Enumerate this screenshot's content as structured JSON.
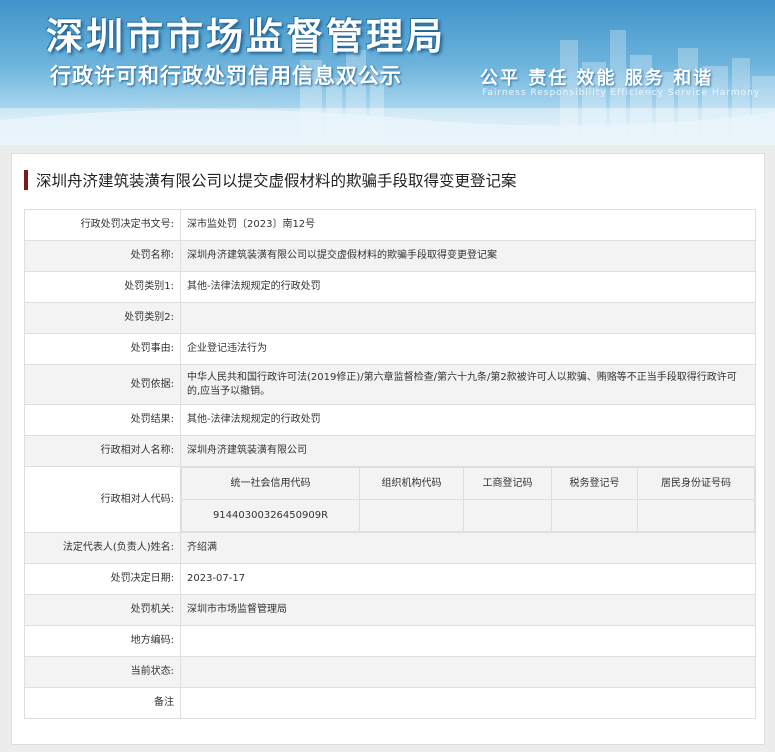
{
  "banner": {
    "title": "深圳市市场监督管理局",
    "subtitle": "行政许可和行政处罚信用信息双公示",
    "slogan": "公平  责任  效能  服务  和谐",
    "slogan_en": "Fairness  Responsibility  Efficiency  Service  Harmony"
  },
  "case_title": "深圳舟济建筑装潢有限公司以提交虚假材料的欺骗手段取得变更登记案",
  "fields": {
    "decision_no": {
      "label": "行政处罚决定书文号:",
      "value": "深市监处罚〔2023〕南12号"
    },
    "penalty_name": {
      "label": "处罚名称:",
      "value": "深圳舟济建筑装潢有限公司以提交虚假材料的欺骗手段取得变更登记案"
    },
    "category1": {
      "label": "处罚类别1:",
      "value": "其他-法律法规规定的行政处罚"
    },
    "category2": {
      "label": "处罚类别2:",
      "value": ""
    },
    "reason": {
      "label": "处罚事由:",
      "value": "企业登记违法行为"
    },
    "basis": {
      "label": "处罚依据:",
      "value": "中华人民共和国行政许可法(2019修正)/第六章监督检查/第六十九条/第2款被许可人以欺骗、贿赂等不正当手段取得行政许可的,应当予以撤销。"
    },
    "result": {
      "label": "处罚结果:",
      "value": "其他-法律法规规定的行政处罚"
    },
    "party_name": {
      "label": "行政相对人名称:",
      "value": "深圳舟济建筑装潢有限公司"
    },
    "party_code": {
      "label": "行政相对人代码:",
      "headers": [
        "统一社会信用代码",
        "组织机构代码",
        "工商登记码",
        "税务登记号",
        "居民身份证号码"
      ],
      "values": [
        "91440300326450909R",
        "",
        "",
        "",
        ""
      ]
    },
    "legal_rep": {
      "label": "法定代表人(负责人)姓名:",
      "value": "齐绍满"
    },
    "decision_date": {
      "label": "处罚决定日期:",
      "value": "2023-07-17"
    },
    "authority": {
      "label": "处罚机关:",
      "value": "深圳市市场监督管理局"
    },
    "region_code": {
      "label": "地方编码:",
      "value": ""
    },
    "status": {
      "label": "当前状态:",
      "value": ""
    },
    "remark": {
      "label": "备注",
      "value": ""
    }
  },
  "colors": {
    "accent_bar": "#7a1a1a",
    "banner_top": "#3f93c8",
    "row_alt": "#f3f3f3",
    "border": "#dedede"
  }
}
